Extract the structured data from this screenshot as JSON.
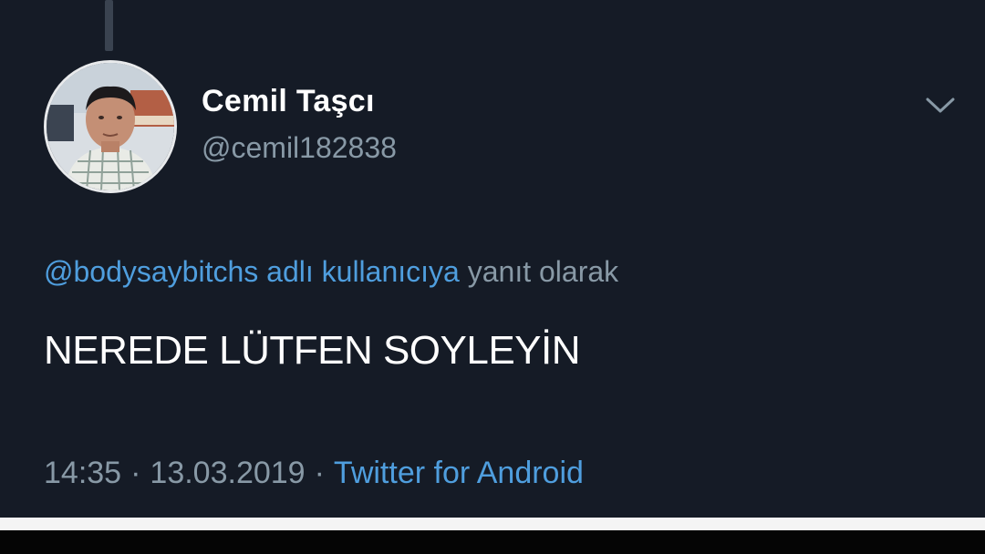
{
  "user": {
    "display_name": "Cemil Taşcı",
    "handle": "@cemil182838"
  },
  "reply": {
    "mention": "@bodysaybitchs adlı kullanıcıya",
    "suffix": "yanıt olarak"
  },
  "tweet": {
    "text": "NEREDE LÜTFEN SOYLEYİN"
  },
  "meta": {
    "time": "14:35",
    "separator": "·",
    "date": "13.03.2019",
    "source": "Twitter for Android"
  },
  "icons": {
    "menu": "chevron-down-icon",
    "avatar": "avatar"
  },
  "colors": {
    "background": "#151b26",
    "link": "#4f9ede",
    "secondary_text": "#8899a6",
    "primary_text": "#ffffff"
  }
}
